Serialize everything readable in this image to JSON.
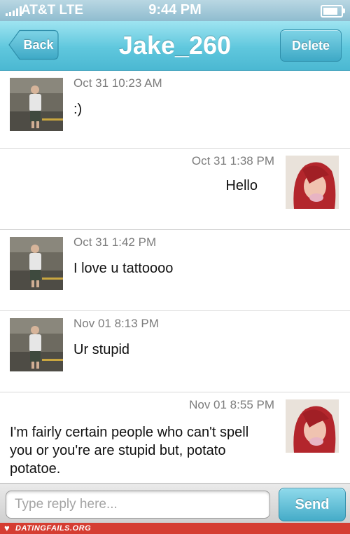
{
  "status_bar": {
    "carrier": "AT&T  LTE",
    "time": "9:44 PM"
  },
  "nav": {
    "back_label": "Back",
    "title": "Jake_260",
    "delete_label": "Delete"
  },
  "messages": [
    {
      "direction": "incoming",
      "timestamp": "Oct 31 10:23 AM",
      "text": ":)"
    },
    {
      "direction": "outgoing",
      "timestamp": "Oct 31 1:38 PM",
      "text": "Hello"
    },
    {
      "direction": "incoming",
      "timestamp": "Oct 31 1:42 PM",
      "text": "I love u tattoooo"
    },
    {
      "direction": "incoming",
      "timestamp": "Nov 01 8:13 PM",
      "text": "Ur stupid"
    },
    {
      "direction": "outgoing",
      "timestamp": "Nov 01 8:55 PM",
      "text": "I'm fairly certain people who can't spell you or you're are stupid but, potato potatoe."
    }
  ],
  "reply": {
    "placeholder": "Type reply here...",
    "send_label": "Send"
  },
  "watermark": {
    "text": "DATINGFAILS.ORG"
  },
  "colors": {
    "nav_accent": "#5fc7dd",
    "button_blue": "#45acc8",
    "watermark_red": "#d53d32"
  }
}
